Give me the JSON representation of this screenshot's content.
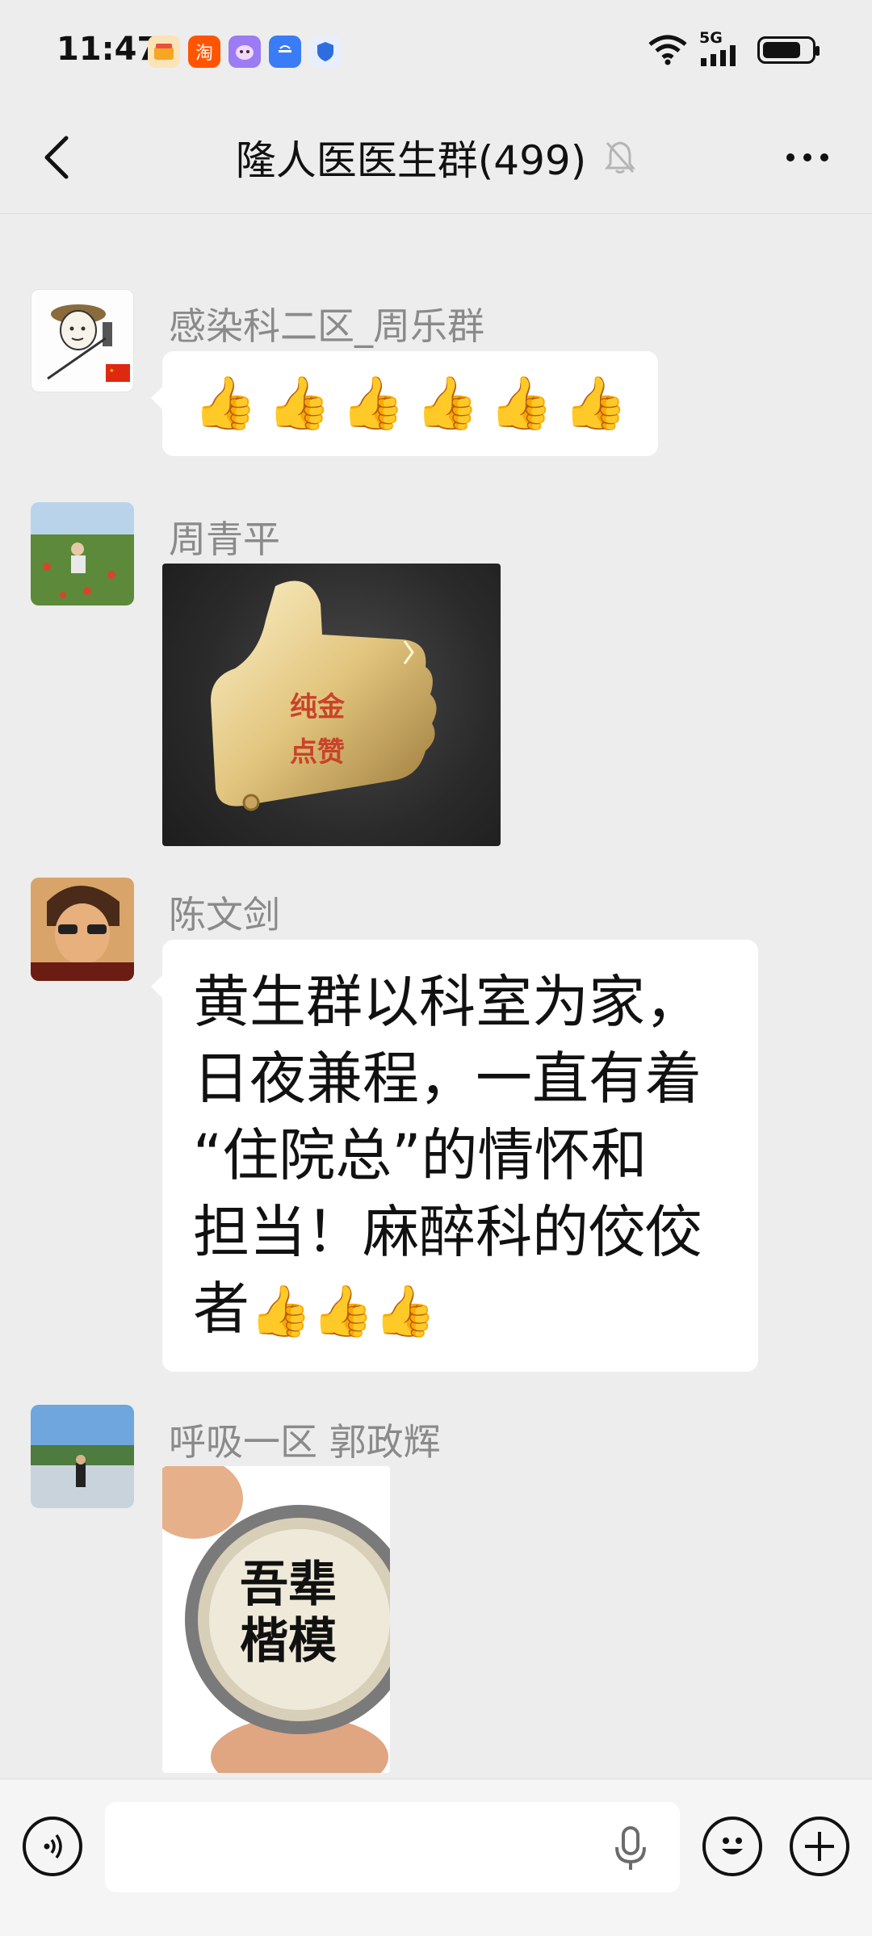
{
  "status_bar": {
    "time": "11:47",
    "network": "5G",
    "apps": [
      {
        "name": "wallet-app-icon",
        "color": "#f6a623"
      },
      {
        "name": "taobao-app-icon",
        "label": "淘",
        "color": "#ff5500"
      },
      {
        "name": "cartoon-app-icon",
        "color": "#9b7cf2"
      },
      {
        "name": "app-market-icon",
        "color": "#3a7cf6"
      },
      {
        "name": "security-shield-icon",
        "color": "#2d6de0"
      }
    ]
  },
  "header": {
    "title": "隆人医医生群(499)",
    "muted_icon": "bell-muted-icon"
  },
  "messages": [
    {
      "sender": "感染科二区_周乐群",
      "type": "text",
      "emoji": [
        "👍",
        "👍",
        "👍",
        "👍",
        "👍",
        "👍"
      ]
    },
    {
      "sender": "周青平",
      "type": "image",
      "image_text": [
        "纯金",
        "点赞"
      ]
    },
    {
      "sender": "陈文剑",
      "type": "text",
      "lines": [
        "黄生群以科室为家，",
        "日夜兼程，一直有着",
        "“住院总”的情怀和",
        "担当！麻醉科的佼佼"
      ],
      "last_line": "者",
      "emoji": [
        "👍",
        "👍",
        "👍"
      ]
    },
    {
      "sender": "呼吸一区 郭政辉",
      "type": "image",
      "image_text": [
        "吾辈",
        "楷模"
      ]
    }
  ],
  "input_bar": {
    "voice_icon": "voice-toggle-icon",
    "emoji_icon": "emoji-icon",
    "plus_icon": "plus-icon",
    "mic_icon": "microphone-icon",
    "value": ""
  },
  "colors": {
    "background": "#ededed",
    "bubble": "#ffffff",
    "sender": "#8a8a8a"
  }
}
